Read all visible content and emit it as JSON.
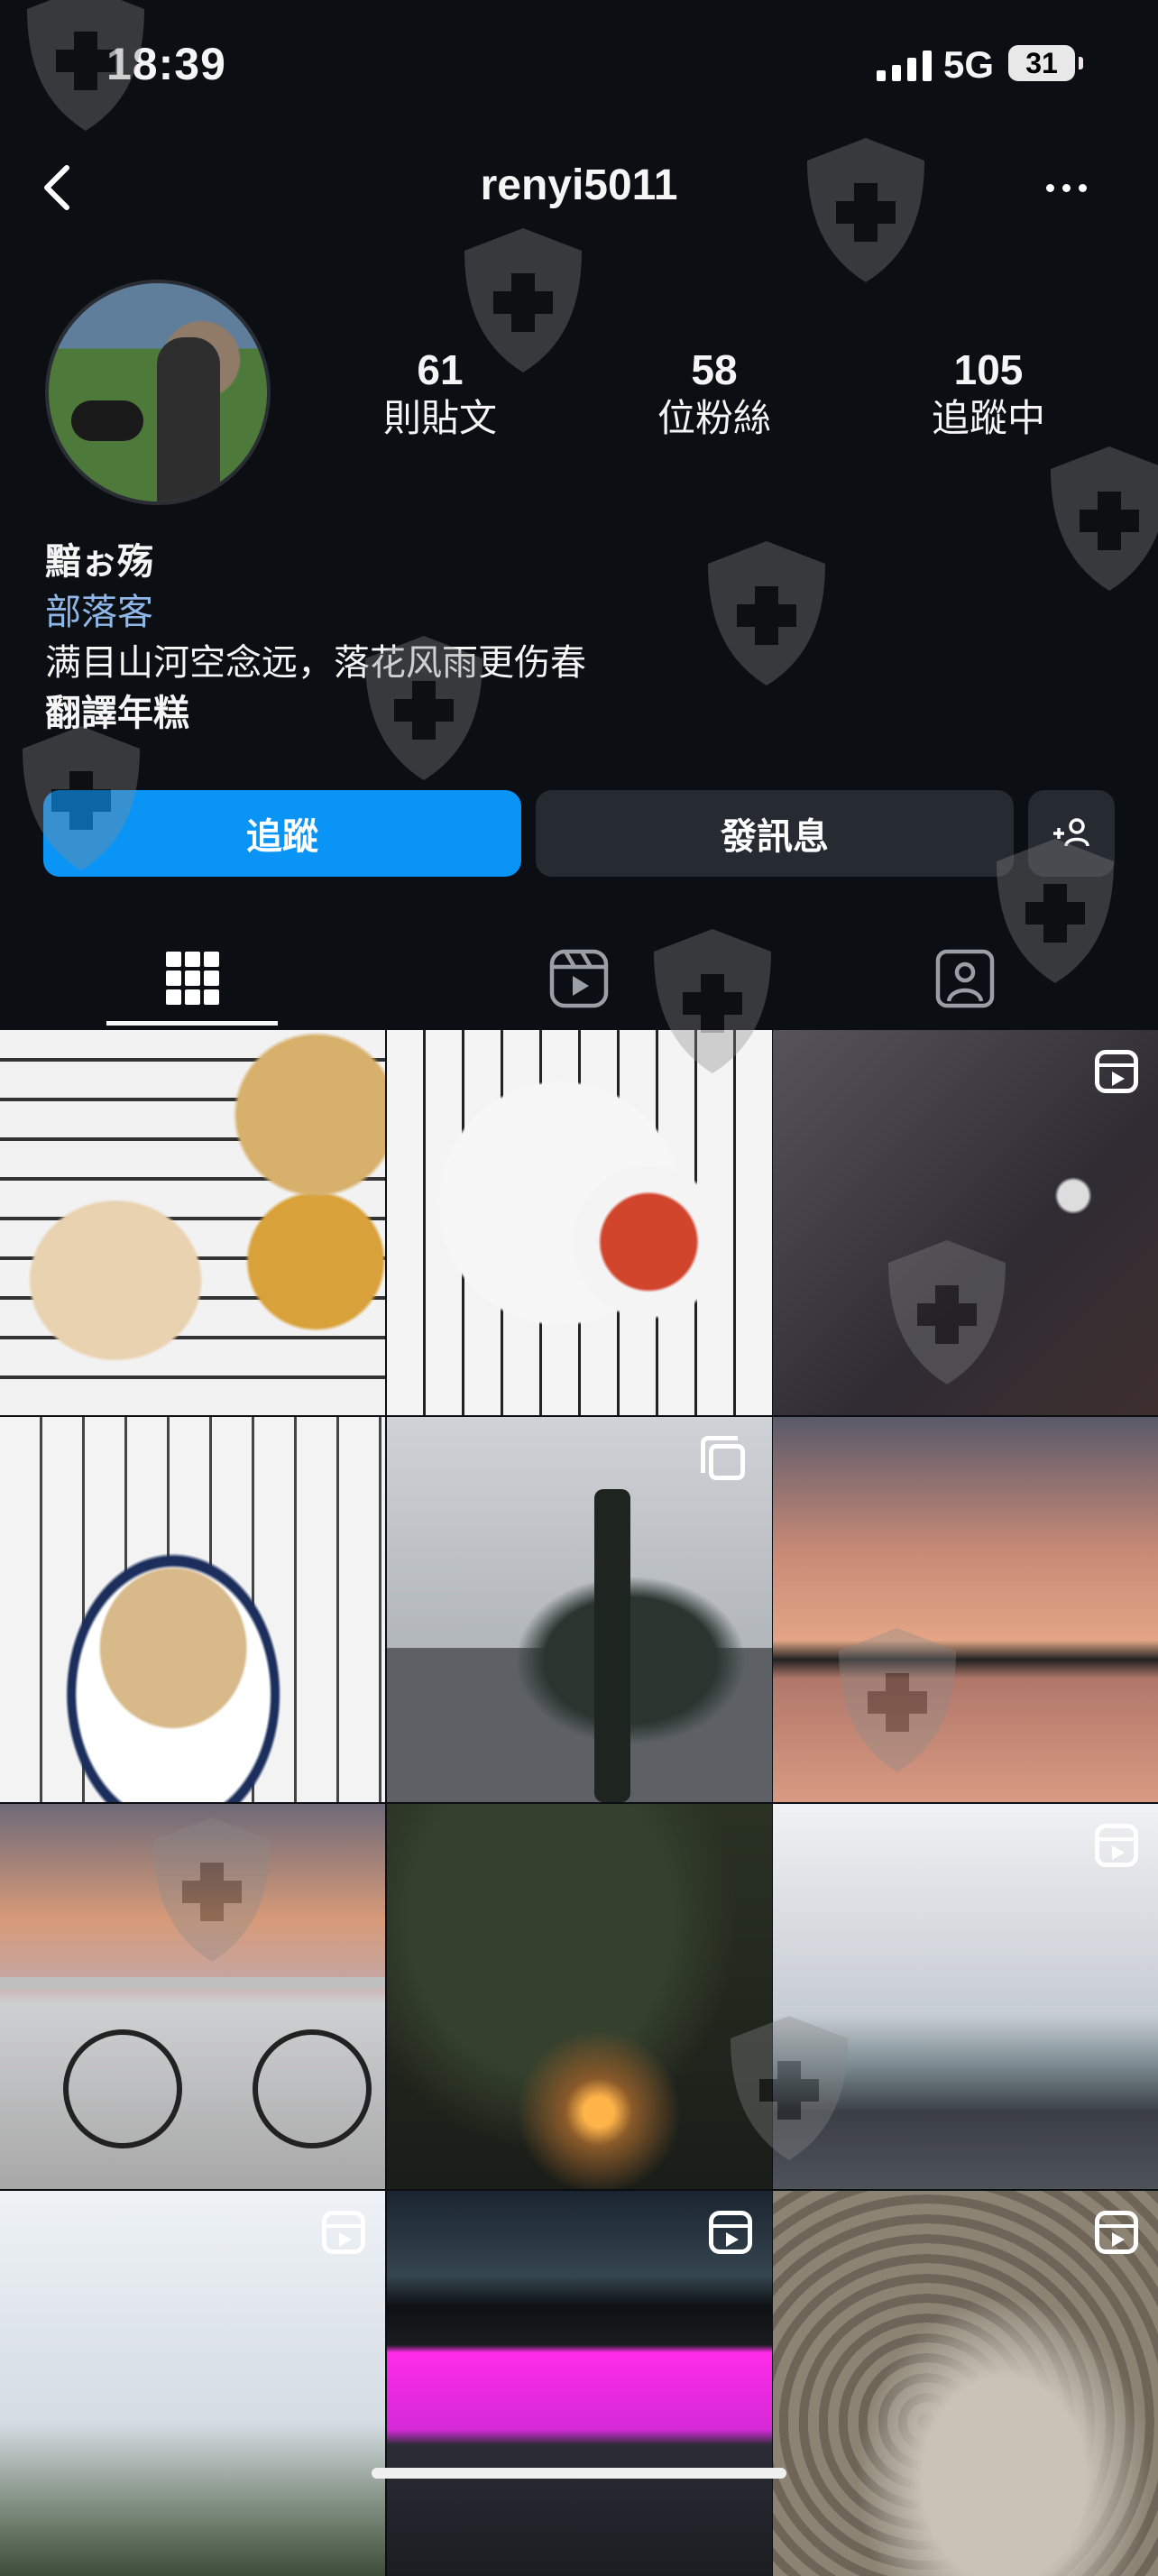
{
  "status_bar": {
    "time": "18:39",
    "network": "5G",
    "battery": "31"
  },
  "header": {
    "username": "renyi5011"
  },
  "profile": {
    "stats": [
      {
        "count": "61",
        "label": "則貼文"
      },
      {
        "count": "58",
        "label": "位粉絲"
      },
      {
        "count": "105",
        "label": "追蹤中"
      }
    ],
    "name": "黯ぉ殇",
    "category": "部落客",
    "bio": "满目山河空念远，落花风雨更伤春",
    "translate": "翻譯年糕"
  },
  "buttons": {
    "follow": "追蹤",
    "message": "發訊息"
  },
  "colors": {
    "accent": "#0a95f6",
    "background": "#0b0e13",
    "category_link": "#8fb7e8"
  },
  "tabs": [
    {
      "name": "posts-grid",
      "icon": "grid-icon",
      "selected": true
    },
    {
      "name": "reels",
      "icon": "reels-icon",
      "selected": false
    },
    {
      "name": "tagged",
      "icon": "tagged-person-icon",
      "selected": false
    }
  ],
  "grid": [
    {
      "type": "photo",
      "subject": "chicken-rice-meal"
    },
    {
      "type": "photo",
      "subject": "plated-dishes"
    },
    {
      "type": "reel",
      "subject": "dark-room"
    },
    {
      "type": "photo",
      "subject": "coconut-dessert"
    },
    {
      "type": "carousel",
      "subject": "lake-tree"
    },
    {
      "type": "photo",
      "subject": "sunset-lake"
    },
    {
      "type": "photo",
      "subject": "bicycle-sunset"
    },
    {
      "type": "photo",
      "subject": "palm-sunset"
    },
    {
      "type": "reel",
      "subject": "road-clouds"
    },
    {
      "type": "reel",
      "subject": "plane-sky"
    },
    {
      "type": "reel",
      "subject": "pink-lights"
    },
    {
      "type": "reel",
      "subject": "water-feet"
    }
  ]
}
